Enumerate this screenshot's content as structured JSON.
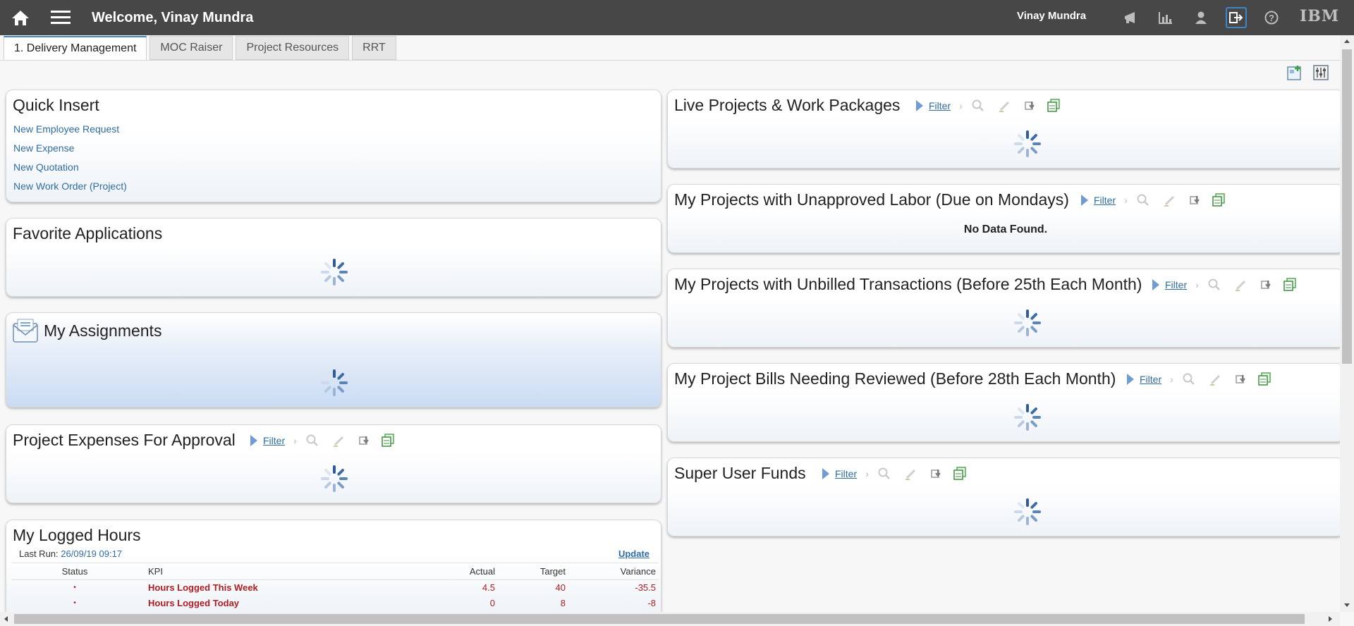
{
  "header": {
    "title": "Welcome, Vinay Mundra",
    "user": "Vinay Mundra",
    "brand": "IBM"
  },
  "tabs": [
    {
      "label": "1. Delivery Management",
      "active": true
    },
    {
      "label": "MOC Raiser",
      "active": false
    },
    {
      "label": "Project Resources",
      "active": false
    },
    {
      "label": "RRT",
      "active": false
    }
  ],
  "quick_insert": {
    "title": "Quick Insert",
    "links": [
      "New Employee Request",
      "New Expense",
      "New Quotation",
      "New Work Order (Project)"
    ]
  },
  "favorite_applications": {
    "title": "Favorite Applications"
  },
  "my_assignments": {
    "title": "My Assignments"
  },
  "project_expenses": {
    "title": "Project Expenses For Approval",
    "filter": "Filter"
  },
  "logged_hours": {
    "title": "My Logged Hours",
    "last_run_label": "Last Run:",
    "last_run_value": "26/09/19 09:17",
    "update": "Update",
    "columns": [
      "Status",
      "KPI",
      "Actual",
      "Target",
      "Variance"
    ],
    "rows": [
      {
        "status": "•",
        "kpi": "Hours Logged This Week",
        "actual": "4.5",
        "target": "40",
        "variance": "-35.5"
      },
      {
        "status": "•",
        "kpi": "Hours Logged Today",
        "actual": "0",
        "target": "8",
        "variance": "-8"
      }
    ]
  },
  "live_projects": {
    "title": "Live Projects & Work Packages",
    "filter": "Filter"
  },
  "unapproved_labor": {
    "title": "My Projects with Unapproved Labor (Due on Mondays)",
    "filter": "Filter",
    "message": "No Data Found."
  },
  "unbilled_transactions": {
    "title": "My Projects with Unbilled Transactions (Before 25th Each Month)",
    "filter": "Filter"
  },
  "bills_review": {
    "title": "My Project Bills Needing Reviewed (Before 28th Each Month)",
    "filter": "Filter"
  },
  "super_user_funds": {
    "title": "Super User Funds",
    "filter": "Filter"
  },
  "colors": {
    "topbar": "#474747",
    "link": "#2e6da4",
    "kpi_red": "#b01c22"
  }
}
